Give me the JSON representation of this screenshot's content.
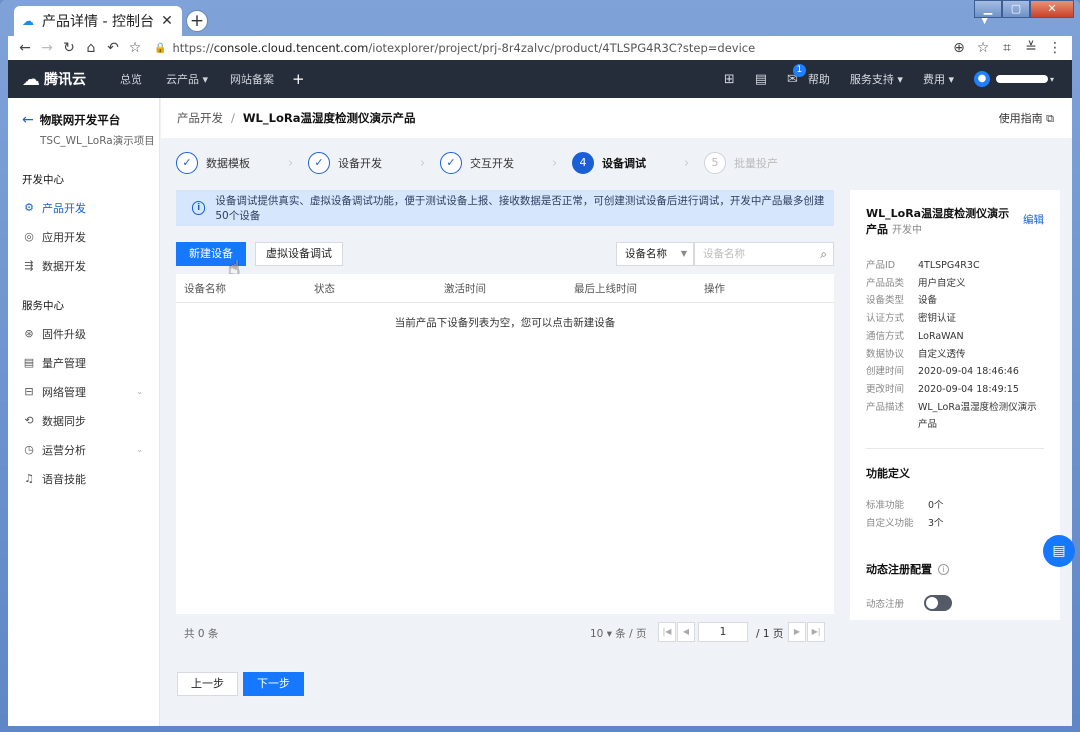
{
  "browser": {
    "tab_title": "产品详情 - 控制台",
    "url_prefix": "https://",
    "url_host": "console.cloud.tencent.com",
    "url_path": "/iotexplorer/project/prj-8r4zalvc/product/4TLSPG4R3C?step=device"
  },
  "topnav": {
    "logo": "腾讯云",
    "items": [
      "总览",
      "云产品 ▾",
      "网站备案"
    ],
    "help": "帮助",
    "support": "服务支持 ▾",
    "billing": "费用 ▾",
    "badge": "1"
  },
  "sidebar": {
    "platform": "物联网开发平台",
    "project": "TSC_WL_LoRa演示项目",
    "dev_center": "开发中心",
    "dev_items": [
      "产品开发",
      "应用开发",
      "数据开发"
    ],
    "service_center": "服务中心",
    "service_items": [
      "固件升级",
      "量产管理",
      "网络管理",
      "数据同步",
      "运营分析",
      "语音技能"
    ]
  },
  "header": {
    "breadcrumb_parent": "产品开发",
    "breadcrumb_current": "WL_LoRa温湿度检测仪演示产品",
    "guide": "使用指南"
  },
  "steps": [
    {
      "label": "数据模板",
      "num": "✓"
    },
    {
      "label": "设备开发",
      "num": "✓"
    },
    {
      "label": "交互开发",
      "num": "✓"
    },
    {
      "label": "设备调试",
      "num": "4"
    },
    {
      "label": "批量投产",
      "num": "5"
    }
  ],
  "info": "设备调试提供真实、虚拟设备调试功能，便于测试设备上报、接收数据是否正常，可创建测试设备后进行调试，开发中产品最多创建50个设备",
  "toolbar": {
    "new_device": "新建设备",
    "virtual_debug": "虚拟设备调试",
    "filter_select": "设备名称",
    "search_placeholder": "设备名称"
  },
  "table": {
    "columns": [
      "设备名称",
      "状态",
      "激活时间",
      "最后上线时间",
      "操作"
    ],
    "empty": "当前产品下设备列表为空，您可以点击新建设备"
  },
  "pager": {
    "total": "共 0 条",
    "page_size": "10 ▾ 条 / 页",
    "page": "1",
    "total_pages": "/ 1 页"
  },
  "footer": {
    "prev": "上一步",
    "next": "下一步"
  },
  "product": {
    "title": "WL_LoRa温湿度检测仪演示产品",
    "status": "开发中",
    "edit": "编辑",
    "rows": [
      [
        "产品ID",
        "4TLSPG4R3C"
      ],
      [
        "产品品类",
        "用户自定义"
      ],
      [
        "设备类型",
        "设备"
      ],
      [
        "认证方式",
        "密钥认证"
      ],
      [
        "通信方式",
        "LoRaWAN"
      ],
      [
        "数据协议",
        "自定义透传"
      ],
      [
        "创建时间",
        "2020-09-04 18:46:46"
      ],
      [
        "更改时间",
        "2020-09-04 18:49:15"
      ],
      [
        "产品描述",
        "WL_LoRa温湿度检测仪演示产品"
      ]
    ],
    "func_title": "功能定义",
    "func_rows": [
      [
        "标准功能",
        "0个"
      ],
      [
        "自定义功能",
        "3个"
      ]
    ],
    "dyn_title": "动态注册配置",
    "dyn_label": "动态注册",
    "dyn_enabled": false
  },
  "colors": {
    "accent": "#1677ff",
    "topbar": "#262d3a",
    "info_bg": "#d5e6fd"
  }
}
